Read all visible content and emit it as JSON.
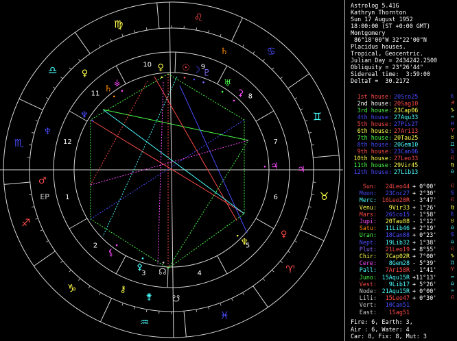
{
  "header": [
    "Astrolog 5.41G",
    "Kathryn Thornton",
    "Sun 17 August 1952",
    "18:00:00 (ST +0:00 GMT)",
    "Montgomery",
    " 86°18'00\"W 32°22'00\"N",
    "Placidus houses.",
    "Tropical, Geocentric.",
    "Julian Day = 2434242.2500",
    "Obliquity = 23°26'44\"",
    "Sidereal time:  3:59:00",
    "DeltaT =  30.2172"
  ],
  "houses": [
    {
      "label": "1st house:",
      "value": "20Sco25",
      "label_color": "#ff4a4a",
      "value_color": "#4a4aff",
      "glyph": "♏",
      "glyph_color": "#4a4aff"
    },
    {
      "label": "2nd house:",
      "value": "20Sag10",
      "label_color": "#ffffff",
      "value_color": "#ff4a4a",
      "glyph": "♐",
      "glyph_color": "#ff4a4a"
    },
    {
      "label": "3rd house:",
      "value": "23Cap06",
      "label_color": "#4aff4a",
      "value_color": "#ffff4a",
      "glyph": "♑",
      "glyph_color": "#ffff4a"
    },
    {
      "label": "4th house:",
      "value": "27Aqu33",
      "label_color": "#4a4aff",
      "value_color": "#4affff",
      "glyph": "♒",
      "glyph_color": "#4affff"
    },
    {
      "label": "5th house:",
      "value": "27Pis27",
      "label_color": "#ff4a4a",
      "value_color": "#4a4aff",
      "glyph": "♓",
      "glyph_color": "#4a4aff"
    },
    {
      "label": "6th house:",
      "value": "27Ari13",
      "label_color": "#ffff4a",
      "value_color": "#ff4a4a",
      "glyph": "♈",
      "glyph_color": "#ff4a4a"
    },
    {
      "label": "7th house:",
      "value": "20Tau25",
      "label_color": "#4aff4a",
      "value_color": "#ffff4a",
      "glyph": "♉",
      "glyph_color": "#ffff4a"
    },
    {
      "label": "8th house:",
      "value": "20Gem10",
      "label_color": "#4a4aff",
      "value_color": "#4affff",
      "glyph": "♊",
      "glyph_color": "#4affff"
    },
    {
      "label": "9th house:",
      "value": "23Can06",
      "label_color": "#ff4a4a",
      "value_color": "#4a4aff",
      "glyph": "♋",
      "glyph_color": "#4a4aff"
    },
    {
      "label": "10th house:",
      "value": "27Leo33",
      "label_color": "#ffff4a",
      "value_color": "#ff4a4a",
      "glyph": "♌",
      "glyph_color": "#ff4a4a"
    },
    {
      "label": "11th house:",
      "value": "29Vir45",
      "label_color": "#4aff4a",
      "value_color": "#ffff4a",
      "glyph": "♍",
      "glyph_color": "#ffff4a"
    },
    {
      "label": "12th house:",
      "value": "27Lib13",
      "label_color": "#4a4aff",
      "value_color": "#4affff",
      "glyph": "♎",
      "glyph_color": "#4affff"
    }
  ],
  "planets": [
    {
      "name": "Sun:",
      "pos": "24Leo44",
      "lat": "+ 0°00'",
      "name_color": "#ff4a4a",
      "pos_color": "#ff4a4a",
      "glyph": "♌",
      "glyph_color": "#ff4a4a"
    },
    {
      "name": "Moon:",
      "pos": "23Cnc27",
      "lat": "+ 2°30'",
      "name_color": "#4a4aff",
      "pos_color": "#4a4aff",
      "glyph": "♋",
      "glyph_color": "#4a4aff"
    },
    {
      "name": "Merc:",
      "pos": "16Leo20R",
      "lat": "- 3°47'",
      "name_color": "#4affff",
      "pos_color": "#ff4a4a",
      "glyph": "♌",
      "glyph_color": "#ff4a4a"
    },
    {
      "name": "Venu:",
      "pos": "9Vir33",
      "lat": "+ 1°26'",
      "name_color": "#ffff4a",
      "pos_color": "#ffff4a",
      "glyph": "♍",
      "glyph_color": "#ffff4a"
    },
    {
      "name": "Mars:",
      "pos": "26Sco15",
      "lat": "- 1°58'",
      "name_color": "#ff4a4a",
      "pos_color": "#4a4aff",
      "glyph": "♏",
      "glyph_color": "#4a4aff"
    },
    {
      "name": "Jupi:",
      "pos": "20Tau08",
      "lat": "- 1°12'",
      "name_color": "#ff4aff",
      "pos_color": "#ffff4a",
      "glyph": "♉",
      "glyph_color": "#ffff4a"
    },
    {
      "name": "Satu:",
      "pos": "11Lib46",
      "lat": "+ 2°19'",
      "name_color": "#ff8c00",
      "pos_color": "#4affff",
      "glyph": "♎",
      "glyph_color": "#4affff"
    },
    {
      "name": "Uran:",
      "pos": "18Can08",
      "lat": "+ 0°23'",
      "name_color": "#4aff4a",
      "pos_color": "#4a4aff",
      "glyph": "♋",
      "glyph_color": "#4a4aff"
    },
    {
      "name": "Nept:",
      "pos": "19Lib32",
      "lat": "+ 1°38'",
      "name_color": "#4a4aff",
      "pos_color": "#4affff",
      "glyph": "♎",
      "glyph_color": "#4affff"
    },
    {
      "name": "Plut:",
      "pos": "21Leo19",
      "lat": "+ 8°55'",
      "name_color": "#8c6cff",
      "pos_color": "#ff4a4a",
      "glyph": "♌",
      "glyph_color": "#ff4a4a"
    },
    {
      "name": "Chir:",
      "pos": "7Cap02R",
      "lat": "+ 7°00'",
      "name_color": "#ffff4a",
      "pos_color": "#ffff4a",
      "glyph": "♑",
      "glyph_color": "#ffff4a"
    },
    {
      "name": "Cere:",
      "pos": "8Gem28",
      "lat": "- 5°39'",
      "name_color": "#ff4aff",
      "pos_color": "#4affff",
      "glyph": "♊",
      "glyph_color": "#4affff"
    },
    {
      "name": "Pall:",
      "pos": "7Ari58R",
      "lat": "- 1°41'",
      "name_color": "#4affff",
      "pos_color": "#ff4a4a",
      "glyph": "♈",
      "glyph_color": "#ff4a4a"
    },
    {
      "name": "Juno:",
      "pos": "15Aqu15R",
      "lat": "+11°13'",
      "name_color": "#4aff4a",
      "pos_color": "#4affff",
      "glyph": "♒",
      "glyph_color": "#4affff"
    },
    {
      "name": "Vest:",
      "pos": "9Lib17",
      "lat": "+ 5°26'",
      "name_color": "#ff4a4a",
      "pos_color": "#4affff",
      "glyph": "♎",
      "glyph_color": "#4affff"
    },
    {
      "name": "Node:",
      "pos": "21Aqu15R",
      "lat": "+ 0°00'",
      "name_color": "#c8c8c8",
      "pos_color": "#4affff",
      "glyph": "♒",
      "glyph_color": "#4affff"
    },
    {
      "name": "Lili:",
      "pos": "15Leo47",
      "lat": "+ 0°30'",
      "name_color": "#c8c8c8",
      "pos_color": "#ff4a4a",
      "glyph": "♌",
      "glyph_color": "#ff4a4a"
    },
    {
      "name": "Vert:",
      "pos": "10Can51",
      "lat": "",
      "name_color": "#c8c8c8",
      "pos_color": "#4a4aff",
      "glyph": "",
      "glyph_color": "#4a4aff"
    },
    {
      "name": "East:",
      "pos": "1Sag51",
      "lat": "",
      "name_color": "#c8c8c8",
      "pos_color": "#ff4a4a",
      "glyph": "",
      "glyph_color": "#ff4a4a"
    }
  ],
  "footer": [
    "Fire: 6, Earth: 3,",
    "Air : 6, Water: 4",
    "Car: 8, Fix: 8, Mut: 3"
  ],
  "wheel": {
    "outer_signs": [
      {
        "glyph": "♍",
        "color": "#ffff4a",
        "deg": 110
      },
      {
        "glyph": "♌",
        "color": "#ff4a4a",
        "deg": 80
      },
      {
        "glyph": "♋",
        "color": "#4a4aff",
        "deg": 50
      },
      {
        "glyph": "♊",
        "color": "#4affff",
        "deg": 20
      },
      {
        "glyph": "♉",
        "color": "#ffff4a",
        "deg": -10
      },
      {
        "glyph": "♈",
        "color": "#ff4a4a",
        "deg": -40
      },
      {
        "glyph": "♓",
        "color": "#4a4aff",
        "deg": -70
      },
      {
        "glyph": "♒",
        "color": "#4affff",
        "deg": -100
      },
      {
        "glyph": "♑",
        "color": "#ffff4a",
        "deg": -130
      },
      {
        "glyph": "♐",
        "color": "#ff4a4a",
        "deg": -160
      },
      {
        "glyph": "♏",
        "color": "#4a4aff",
        "deg": 170
      },
      {
        "glyph": "♎",
        "color": "#4affff",
        "deg": 140
      }
    ],
    "ring_planets": [
      {
        "glyph": "♀",
        "color": "#ffff4a",
        "deg": 132
      },
      {
        "glyph": "♆",
        "color": "#4a4aff",
        "deg": 163
      },
      {
        "glyph": "♄",
        "color": "#ff8c00",
        "deg": 66
      },
      {
        "glyph": "♂",
        "color": "#ff4a4a",
        "deg": 185
      },
      {
        "glyph": "EP",
        "color": "#c8c8c8",
        "deg": 192
      },
      {
        "glyph": "⚷",
        "color": "#ffff4a",
        "deg": -112
      },
      {
        "glyph": "⚵",
        "color": "#4affff",
        "deg": -100
      },
      {
        "glyph": "☋",
        "color": "#c8c8c8",
        "deg": -88
      },
      {
        "glyph": "♀",
        "color": "#ff4a4a",
        "deg": -30
      },
      {
        "glyph": "♃",
        "color": "#ff4aff",
        "deg": 0
      }
    ],
    "house_numbers": [
      {
        "num": "10",
        "deg": 103
      },
      {
        "num": "9",
        "deg": 73
      },
      {
        "num": "8",
        "deg": 43
      },
      {
        "num": "7",
        "deg": 15
      },
      {
        "num": "6",
        "deg": -15
      },
      {
        "num": "5",
        "deg": -45
      },
      {
        "num": "4",
        "deg": -75
      },
      {
        "num": "3",
        "deg": -105
      },
      {
        "num": "2",
        "deg": -135
      },
      {
        "num": "1",
        "deg": -165
      },
      {
        "num": "12",
        "deg": 165
      },
      {
        "num": "11",
        "deg": 135
      }
    ],
    "inner_planets": [
      {
        "glyph": "☉",
        "color": "#ff4a4a",
        "deg": 82
      },
      {
        "glyph": "☽",
        "color": "#4a4aff",
        "deg": 76
      },
      {
        "glyph": "♀",
        "color": "#ffff4a",
        "deg": 96
      },
      {
        "glyph": "♇",
        "color": "#8c6cff",
        "deg": 70
      },
      {
        "glyph": "⚳",
        "color": "#ff4aff",
        "deg": 48
      },
      {
        "glyph": "♅",
        "color": "#4aff4a",
        "deg": 57
      },
      {
        "glyph": "♄",
        "color": "#ff8c00",
        "deg": 128
      },
      {
        "glyph": "⚶",
        "color": "#ff4aff",
        "deg": 122
      },
      {
        "glyph": "♆",
        "color": "#4a4aff",
        "deg": 148
      },
      {
        "glyph": "♃",
        "color": "#ff4aff",
        "deg": 2
      },
      {
        "glyph": "⚸",
        "color": "#ff4aff",
        "deg": -126
      },
      {
        "glyph": "⚴",
        "color": "#4affff",
        "deg": -108
      },
      {
        "glyph": "☊",
        "color": "#c8c8c8",
        "deg": -95
      },
      {
        "glyph": "♆",
        "color": "#ffff4a",
        "deg": -45
      }
    ]
  }
}
